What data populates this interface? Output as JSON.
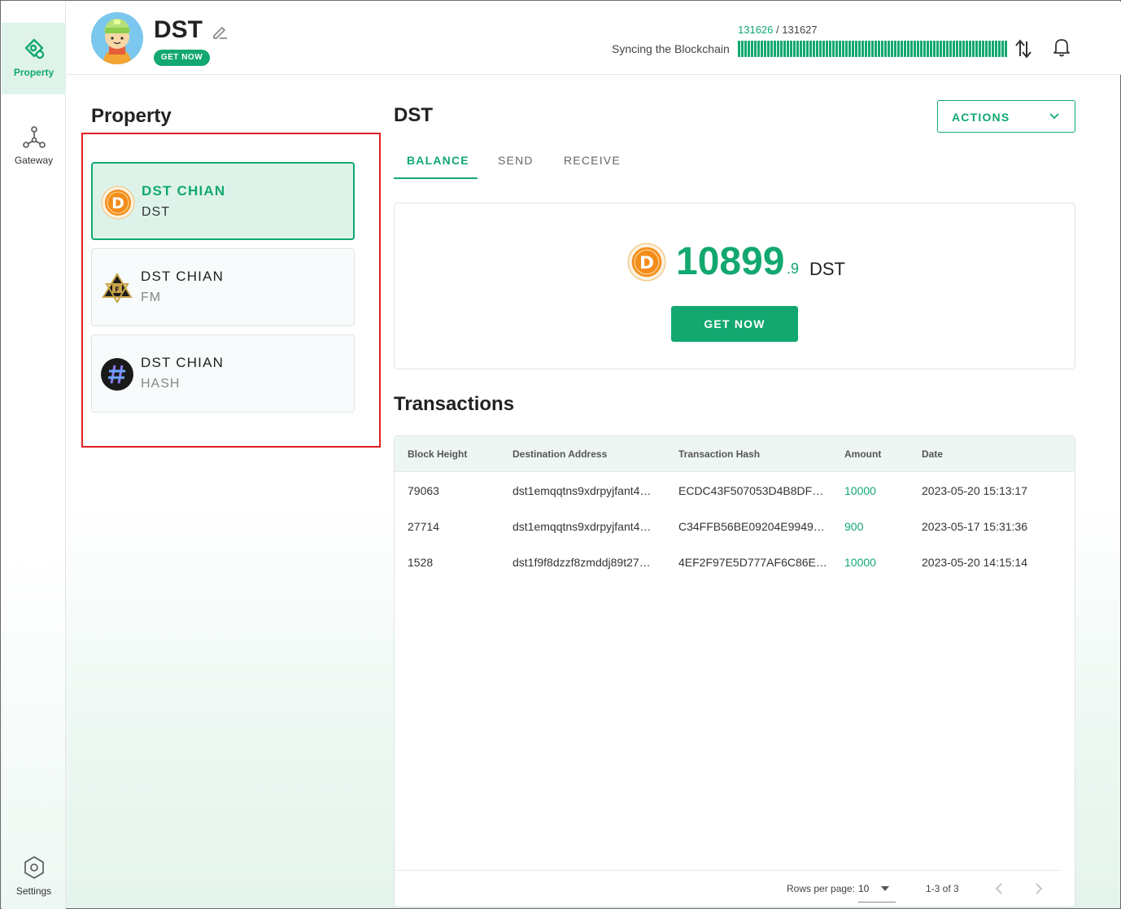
{
  "sidebar": {
    "items": [
      {
        "label": "Property",
        "icon": "property-icon",
        "active": true
      },
      {
        "label": "Gateway",
        "icon": "gateway-icon",
        "active": false
      }
    ],
    "settings_label": "Settings"
  },
  "header": {
    "title": "DST",
    "get_now_label": "GET NOW",
    "sync": {
      "current": "131626",
      "separator": "/",
      "total": "131627",
      "label": "Syncing the Blockchain"
    }
  },
  "property": {
    "title": "Property",
    "assets": [
      {
        "name": "DST CHIAN",
        "symbol": "DST",
        "icon": "dst-coin-icon",
        "active": true
      },
      {
        "name": "DST CHIAN",
        "symbol": "FM",
        "icon": "fm-emblem-icon",
        "active": false
      },
      {
        "name": "DST CHIAN",
        "symbol": "HASH",
        "icon": "hash-icon",
        "active": false
      }
    ]
  },
  "main": {
    "title": "DST",
    "actions_label": "ACTIONS",
    "tabs": [
      {
        "label": "BALANCE",
        "active": true
      },
      {
        "label": "SEND",
        "active": false
      },
      {
        "label": "RECEIVE",
        "active": false
      }
    ],
    "balance": {
      "integer": "10899",
      "decimal": ".9",
      "unit": "DST",
      "button_label": "GET NOW"
    }
  },
  "transactions": {
    "title": "Transactions",
    "columns": [
      "Block Height",
      "Destination Address",
      "Transaction Hash",
      "Amount",
      "Date"
    ],
    "rows": [
      {
        "block": "79063",
        "address": "dst1emqqtns9xdrpyjfant4…",
        "hash": "ECDC43F507053D4B8DF…",
        "amount": "10000",
        "date": "2023-05-20 15:13:17"
      },
      {
        "block": "27714",
        "address": "dst1emqqtns9xdrpyjfant4…",
        "hash": "C34FFB56BE09204E9949…",
        "amount": "900",
        "date": "2023-05-17 15:31:36"
      },
      {
        "block": "1528",
        "address": "dst1f9f8dzzf8zmddj89t27…",
        "hash": "4EF2F97E5D777AF6C86E…",
        "amount": "10000",
        "date": "2023-05-20 14:15:14"
      }
    ],
    "footer": {
      "rows_per_page_label": "Rows per page:",
      "rows_per_page_value": "10",
      "range": "1-3 of 3"
    }
  },
  "colors": {
    "accent": "#12a870",
    "highlight": "#e02020"
  }
}
